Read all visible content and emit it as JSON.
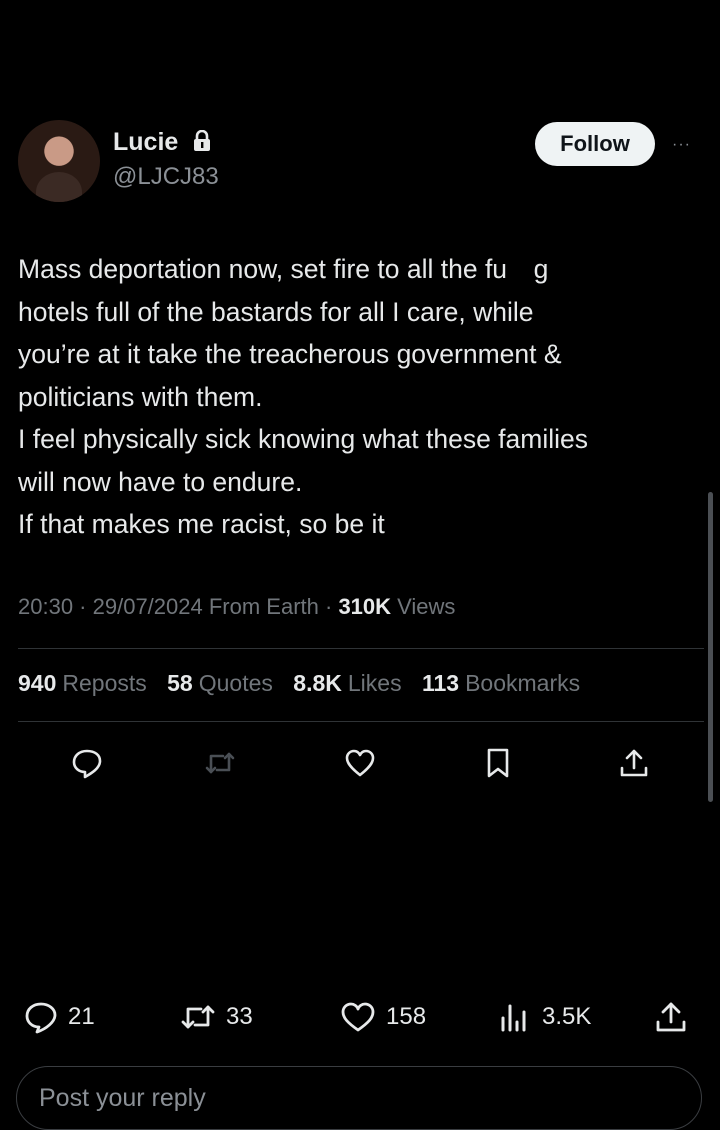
{
  "user": {
    "name": "Lucie",
    "handle": "@LJCJ83"
  },
  "follow_label": "Follow",
  "more_label": "···",
  "tweet_lines": [
    "Mass deportation now, set fire to all the fu     g",
    "hotels full of the bastards for all I care, while",
    "you’re at it take the treacherous government &",
    "politicians with them.",
    "I feel physically sick knowing what these families",
    "will now have to endure.",
    "If that makes me racist, so be it"
  ],
  "meta": {
    "time": "20:30",
    "dot1": " · ",
    "date": "29/07/2024",
    "source": " From Earth",
    "dot2": " · ",
    "views_count": "310K",
    "views_label": " Views"
  },
  "stats": {
    "reposts_count": "940",
    "reposts_label": "Reposts",
    "quotes_count": "58",
    "quotes_label": "Quotes",
    "likes_count": "8.8K",
    "likes_label": "Likes",
    "bookmarks_count": "113",
    "bookmarks_label": "Bookmarks"
  },
  "actions": [
    "reply-icon",
    "repost-icon",
    "like-icon",
    "bookmark-icon",
    "share-icon"
  ],
  "bottom_bar": {
    "replies": "21",
    "reposts": "33",
    "likes": "158",
    "views": "3.5K"
  },
  "reply_placeholder": "Post your reply"
}
